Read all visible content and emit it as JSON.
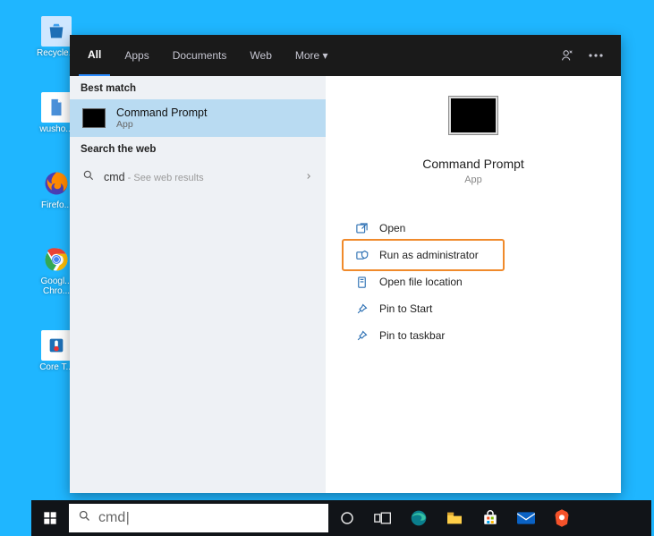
{
  "desktop_icons": [
    {
      "label": "Recycle..."
    },
    {
      "label": "wusho..."
    },
    {
      "label": "Firefo..."
    },
    {
      "label": "Googl...\nChro..."
    },
    {
      "label": "Core T..."
    }
  ],
  "tabs": {
    "items": [
      {
        "label": "All",
        "active": true
      },
      {
        "label": "Apps"
      },
      {
        "label": "Documents"
      },
      {
        "label": "Web"
      },
      {
        "label": "More ▾"
      }
    ]
  },
  "left": {
    "best_match_header": "Best match",
    "best_match": {
      "title": "Command Prompt",
      "subtitle": "App"
    },
    "search_web_header": "Search the web",
    "web": {
      "query": "cmd",
      "hint": " - See web results"
    }
  },
  "right": {
    "title": "Command Prompt",
    "subtitle": "App",
    "actions": [
      {
        "label": "Open",
        "highlight": false
      },
      {
        "label": "Run as administrator",
        "highlight": true
      },
      {
        "label": "Open file location",
        "highlight": false
      },
      {
        "label": "Pin to Start",
        "highlight": false
      },
      {
        "label": "Pin to taskbar",
        "highlight": false
      }
    ]
  },
  "searchbox": {
    "value": "cmd"
  }
}
